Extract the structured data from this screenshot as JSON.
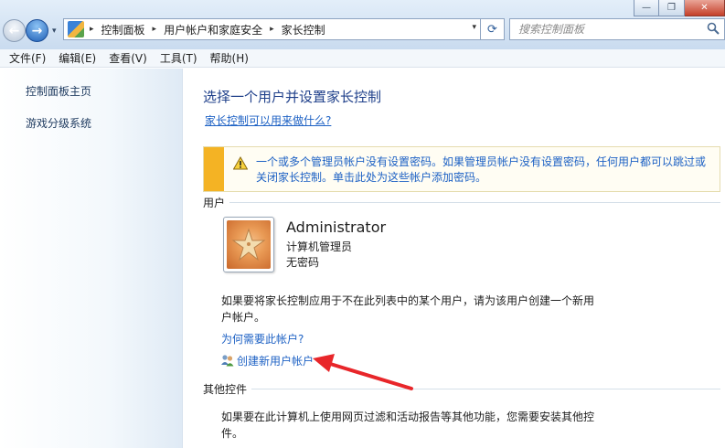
{
  "window": {
    "minimize_glyph": "—",
    "maximize_glyph": "❐",
    "close_glyph": "✕"
  },
  "address_bar": {
    "back_glyph": "←",
    "forward_glyph": "→",
    "recent_glyph": "▾",
    "breadcrumbs": [
      "控制面板",
      "用户帐户和家庭安全",
      "家长控制"
    ],
    "separator": "▸",
    "dropdown_glyph": "▾",
    "refresh_glyph": "⟳",
    "search_placeholder": "搜索控制面板"
  },
  "menubar": {
    "items": [
      "文件(F)",
      "编辑(E)",
      "查看(V)",
      "工具(T)",
      "帮助(H)"
    ]
  },
  "sidebar": {
    "links": [
      "控制面板主页",
      "游戏分级系统"
    ]
  },
  "main": {
    "title": "选择一个用户并设置家长控制",
    "help_link": "家长控制可以用来做什么?",
    "warning": {
      "text": "一个或多个管理员帐户没有设置密码。如果管理员帐户没有设置密码，任何用户都可以跳过或关闭家长控制。单击此处为这些帐户添加密码。",
      "color": "#f4b324"
    },
    "users_section": "用户",
    "account": {
      "name": "Administrator",
      "role": "计算机管理员",
      "password_status": "无密码",
      "avatar_icon": "starfish-icon"
    },
    "note_not_in_list": "如果要将家长控制应用于不在此列表中的某个用户，请为该用户创建一个新用户帐户。",
    "why_link": "为何需要此帐户?",
    "create_link": "创建新用户帐户",
    "other_section": "其他控件",
    "note_other": "如果要在此计算机上使用网页过滤和活动报告等其他功能，您需要安装其他控件。"
  },
  "colors": {
    "link": "#1d61c4",
    "title": "#1e3f8a",
    "arrow": "#e8262a"
  }
}
